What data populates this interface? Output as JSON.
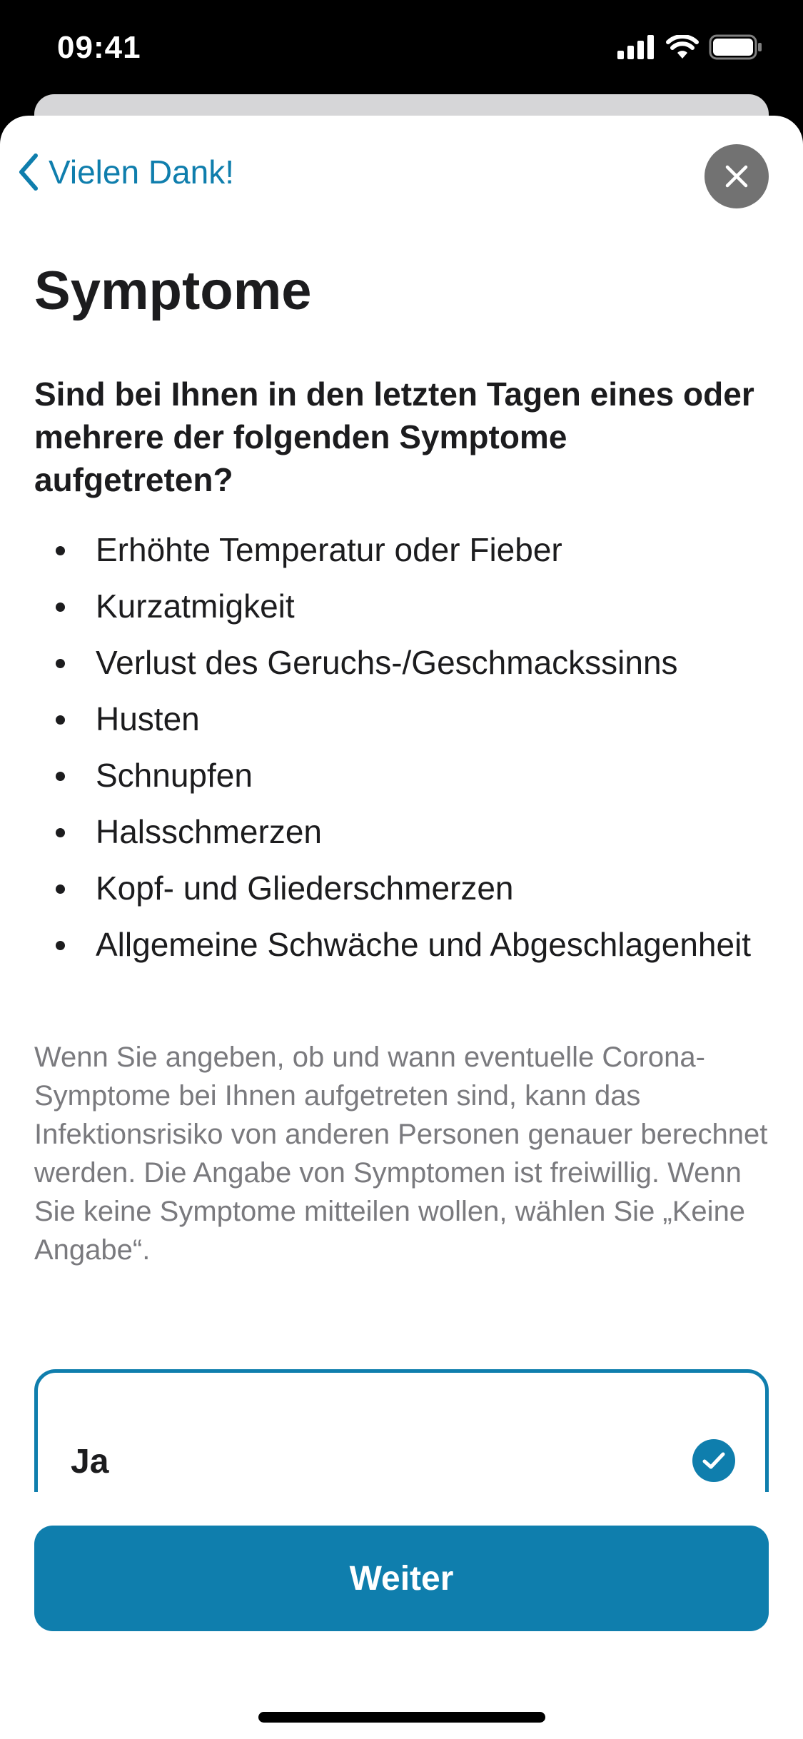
{
  "status_bar": {
    "time": "09:41",
    "icons": [
      "cellular-signal-icon",
      "wifi-icon",
      "battery-icon"
    ]
  },
  "nav": {
    "back_label": "Vielen Dank!",
    "back_icon": "chevron-left-icon",
    "close_icon": "close-icon"
  },
  "page": {
    "title": "Symptome",
    "question": "Sind bei Ihnen in den letzten Tagen eines oder mehrere der folgenden Symptome aufgetreten?",
    "symptoms": [
      "Erhöhte Temperatur oder Fieber",
      "Kurzatmigkeit",
      "Verlust des Geruchs-/Geschmackssinns",
      "Husten",
      "Schnupfen",
      "Halsschmerzen",
      "Kopf- und Gliederschmerzen",
      "Allgemeine Schwäche und Abgeschlagenheit"
    ],
    "info": "Wenn Sie angeben, ob und wann eventuelle Corona-Symptome bei Ihnen aufgetreten sind, kann das Infektionsrisiko von anderen Personen genauer berechnet werden. Die Angabe von Symptomen ist freiwillig. Wenn Sie keine Symptome mitteilen wollen, wählen Sie „Keine Angabe“."
  },
  "answer": {
    "label": "Ja",
    "selected": true,
    "icon": "checkmark-circle-icon"
  },
  "footer": {
    "continue_label": "Weiter"
  },
  "colors": {
    "accent": "#0f7ead",
    "text_primary": "#1c1c1e",
    "text_secondary": "#7a7a7e",
    "close_button": "#727272"
  }
}
